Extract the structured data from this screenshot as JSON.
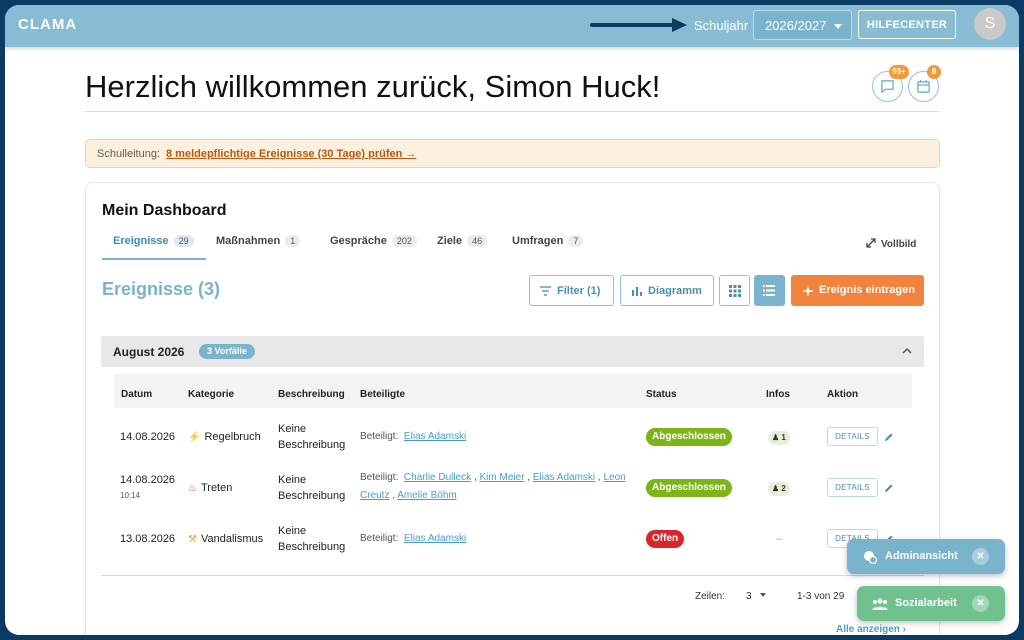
{
  "app": {
    "logo": "CLAMA"
  },
  "header": {
    "school_year_label": "Schuljahr",
    "school_year_value": "2026/2027",
    "help_button": "HILFECENTER",
    "avatar_initial": "S"
  },
  "welcome": {
    "title": "Herzlich willkommen zurück, Simon Huck!"
  },
  "notifications": {
    "messages_count": "99+",
    "calendar_count": "8"
  },
  "alert": {
    "label": "Schulleitung:",
    "link": "8 meldepflichtige Ereignisse (30 Tage) prüfen →"
  },
  "dashboard": {
    "title": "Mein Dashboard",
    "tabs": [
      {
        "label": "Ereignisse",
        "count": "29"
      },
      {
        "label": "Maßnahmen",
        "count": "1"
      },
      {
        "label": "Gespräche",
        "count": "202"
      },
      {
        "label": "Ziele",
        "count": "46"
      },
      {
        "label": "Umfragen",
        "count": "7"
      }
    ],
    "fullview": "Vollbild",
    "section_title": "Ereignisse (3)",
    "filter_button": "Filter (1)",
    "chart_button": "Diagramm",
    "add_button": "Ereignis eintragen",
    "group": {
      "title": "August 2026",
      "pill": "3 Vorfälle"
    },
    "columns": [
      "Datum",
      "Kategorie",
      "Beschreibung",
      "Beteiligte",
      "Status",
      "Infos",
      "Aktion"
    ],
    "rows": [
      {
        "date": "14.08.2026",
        "time": "",
        "category": "Regelbruch",
        "desc1": "Keine",
        "desc2": "Beschreibung",
        "participants_label": "Beteiligt:",
        "participants": [
          "Elias Adamski"
        ],
        "status": "Abgeschlossen",
        "infos": "1",
        "details": "DETAILS"
      },
      {
        "date": "14.08.2026",
        "time": "10:14",
        "category": "Treten",
        "desc1": "Keine",
        "desc2": "Beschreibung",
        "participants_label": "Beteiligt:",
        "participants": [
          "Charlie Dulleck",
          "Kim Meier",
          "Elias Adamski",
          "Leon Creutz",
          "Amelie Böhm"
        ],
        "status": "Abgeschlossen",
        "infos": "2",
        "details": "DETAILS"
      },
      {
        "date": "13.08.2026",
        "time": "",
        "category": "Vandalismus",
        "desc1": "Keine",
        "desc2": "Beschreibung",
        "participants_label": "Beteiligt:",
        "participants": [
          "Elias Adamski"
        ],
        "status": "Offen",
        "infos": "–",
        "details": "DETAILS"
      }
    ],
    "pagination": {
      "rows_label": "Zeilen:",
      "rows_value": "3",
      "range": "1-3 von 29"
    },
    "show_all": "Alle anzeigen ›"
  },
  "floating": {
    "admin": "Adminansicht",
    "social": "Sozialarbeit"
  },
  "colors": {
    "accent": "#7ab3cc",
    "orange": "#f2833c",
    "success": "#7cb518",
    "danger": "#d9262c",
    "social": "#6fc28f"
  }
}
